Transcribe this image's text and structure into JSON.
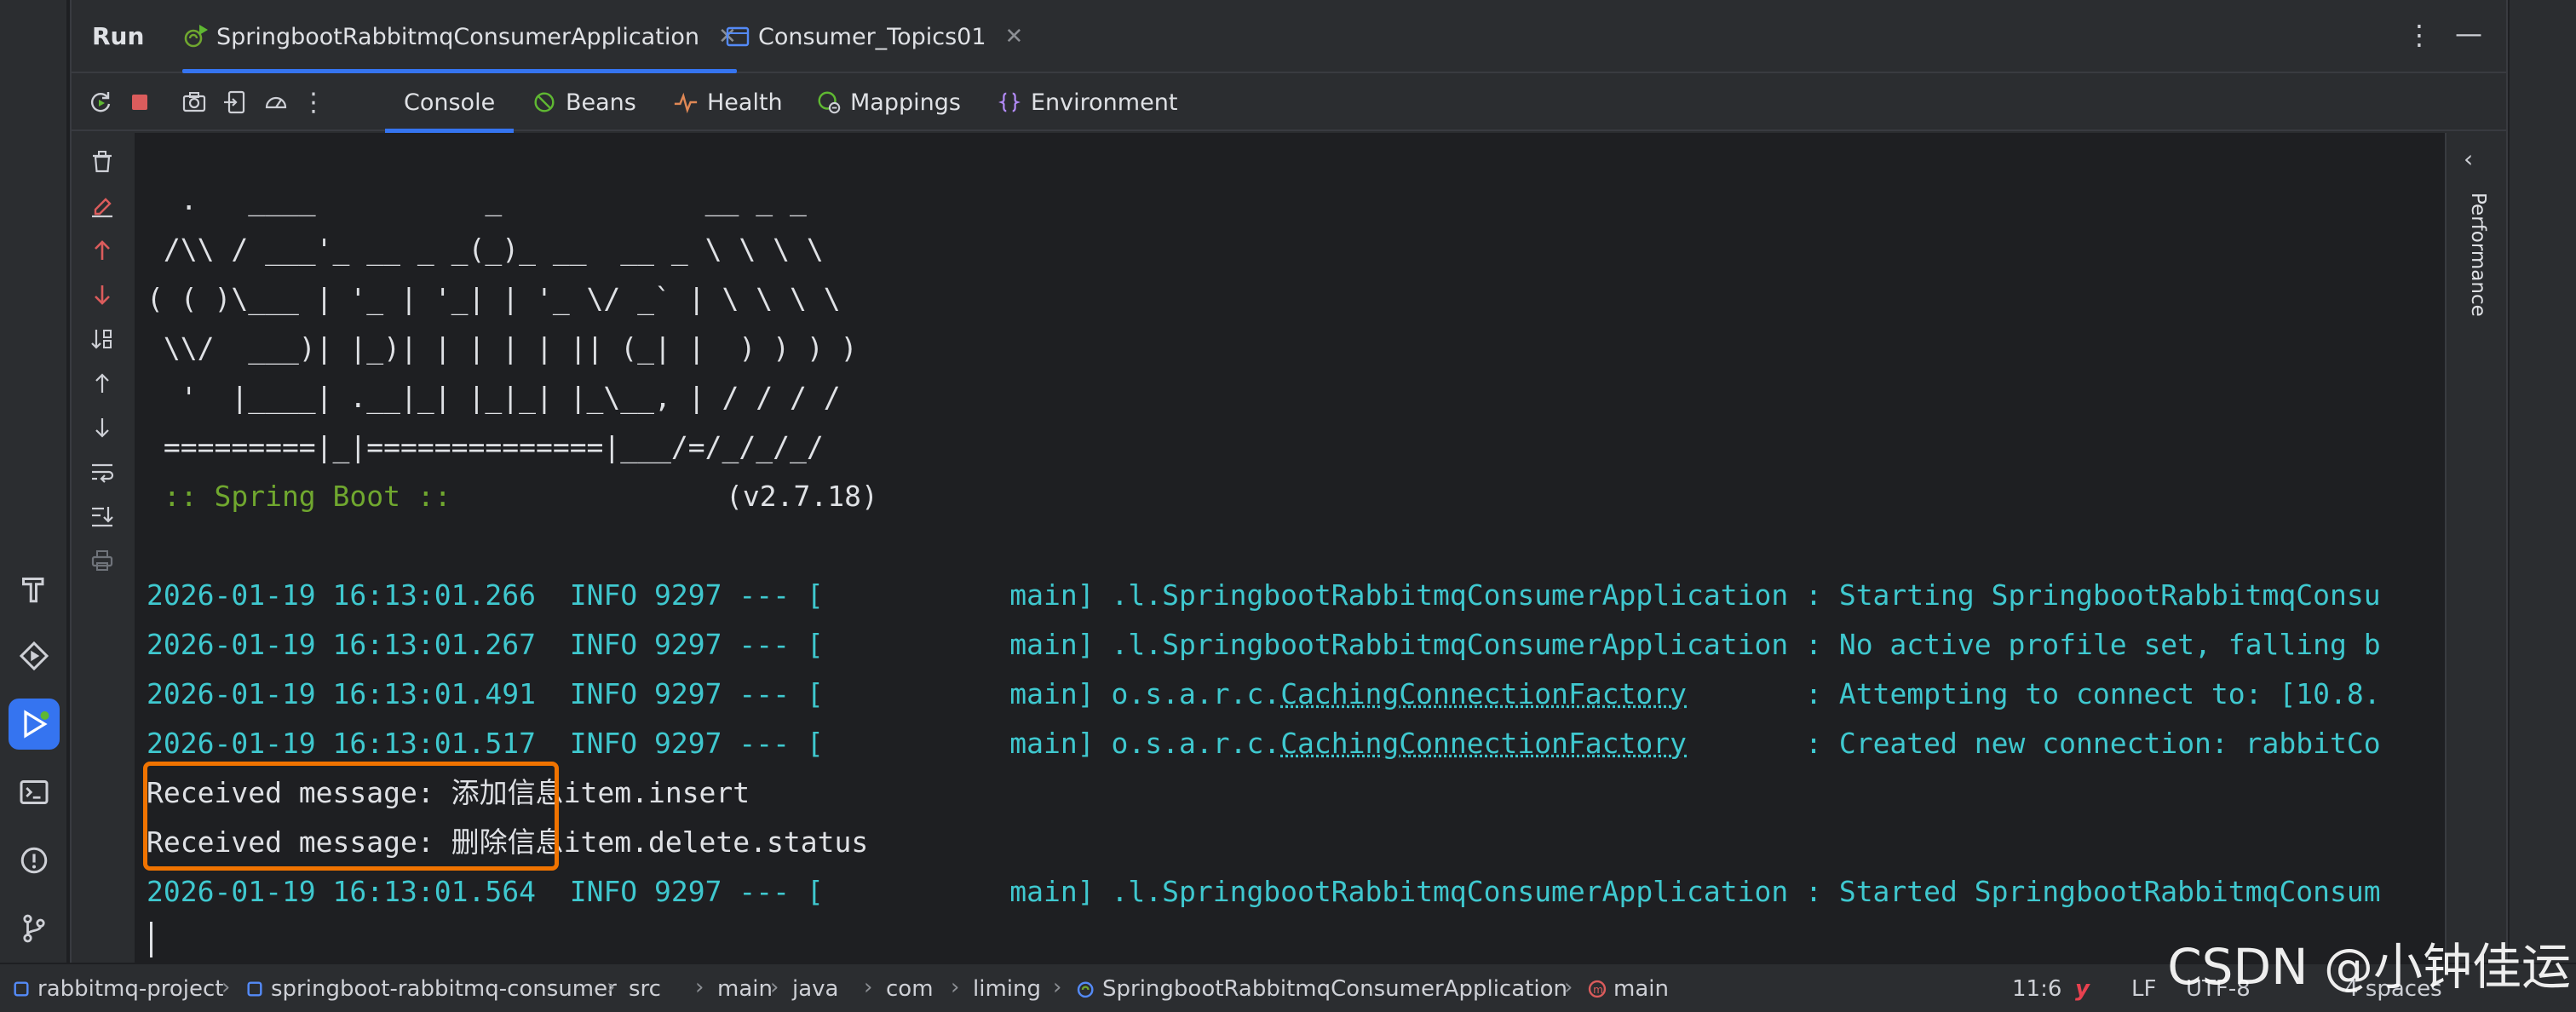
{
  "run": {
    "title": "Run",
    "tabs": [
      {
        "label": "SpringbootRabbitmqConsumerApplication",
        "active": true
      },
      {
        "label": "Consumer_Topics01",
        "active": false
      }
    ]
  },
  "toolbar": {
    "tabs": [
      {
        "label": "Console",
        "icon": "none"
      },
      {
        "label": "Beans",
        "icon": "beans-icon"
      },
      {
        "label": "Health",
        "icon": "health-icon"
      },
      {
        "label": "Mappings",
        "icon": "mappings-icon"
      },
      {
        "label": "Environment",
        "icon": "environment-icon"
      }
    ]
  },
  "console": {
    "banner": [
      "  .   ____          _            __ _ _",
      " /\\\\ / ___'_ __ _ _(_)_ __  __ _ \\ \\ \\ \\",
      "( ( )\\___ | '_ | '_| | '_ \\/ _` | \\ \\ \\ \\",
      " \\\\/  ___)| |_)| | | | | || (_| |  ) ) ) )",
      "  '  |____| .__|_| |_|_| |_\\__, | / / / /",
      " =========|_|==============|___/=/_/_/_/"
    ],
    "spring_label": " :: Spring Boot ::",
    "spring_version": "(v2.7.18)",
    "logs": [
      {
        "ts": "2026-01-19 16:13:01.266",
        "level": "INFO",
        "pid": "9297",
        "thread": "main",
        "logger_pre": ".l.SpringbootRabbitmqConsumerApplication",
        "logger_link": "",
        "logger_pad": "",
        "message": "Starting SpringbootRabbitmqConsu"
      },
      {
        "ts": "2026-01-19 16:13:01.267",
        "level": "INFO",
        "pid": "9297",
        "thread": "main",
        "logger_pre": ".l.SpringbootRabbitmqConsumerApplication",
        "logger_link": "",
        "logger_pad": "",
        "message": "No active profile set, falling b"
      },
      {
        "ts": "2026-01-19 16:13:01.491",
        "level": "INFO",
        "pid": "9297",
        "thread": "main",
        "logger_pre": "o.s.a.r.c.",
        "logger_link": "CachingConnectionFactory",
        "logger_pad": "      ",
        "message": "Attempting to connect to: [10.8."
      },
      {
        "ts": "2026-01-19 16:13:01.517",
        "level": "INFO",
        "pid": "9297",
        "thread": "main",
        "logger_pre": "o.s.a.r.c.",
        "logger_link": "CachingConnectionFactory",
        "logger_pad": "      ",
        "message": "Created new connection: rabbitCo"
      }
    ],
    "received": [
      "Received message: 添加信息item.insert",
      "Received message: 删除信息item.delete.status"
    ],
    "last_log": {
      "ts": "2026-01-19 16:13:01.564",
      "level": "INFO",
      "pid": "9297",
      "thread": "main",
      "logger_pre": ".l.SpringbootRabbitmqConsumerApplication",
      "logger_link": "",
      "logger_pad": "",
      "message": "Started SpringbootRabbitmqConsum"
    }
  },
  "performance_label": "Performance",
  "statusbar": {
    "breadcrumbs": [
      "rabbitmq-project",
      "springboot-rabbitmq-consumer",
      "src",
      "main",
      "java",
      "com",
      "liming",
      "SpringbootRabbitmqConsumerApplication",
      "main"
    ],
    "position": "11:6",
    "line_ending": "LF",
    "encoding": "UTF-8",
    "indent": "4 spaces"
  },
  "watermark": "CSDN @小钟佳运",
  "colors": {
    "accent": "#3574f0",
    "highlight": "#f07300",
    "log": "#3fc8cf",
    "spring": "#70a72f"
  }
}
